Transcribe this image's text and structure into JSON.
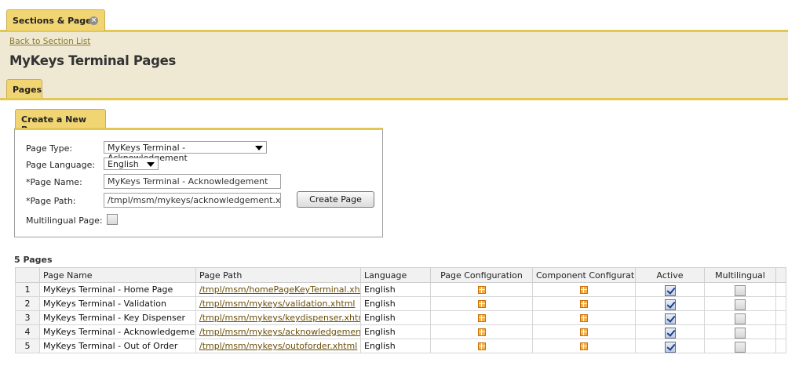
{
  "window": {
    "tab_label": "Sections & Pages",
    "close_glyph": "×"
  },
  "header": {
    "back_link": "Back to Section List",
    "title": "MyKeys Terminal Pages",
    "sub_tab": "Pages"
  },
  "create_form": {
    "tab_label": "Create a New Page",
    "page_type_label": "Page Type:",
    "page_type_value": "MyKeys Terminal - Acknowledgement",
    "page_language_label": "Page Language:",
    "page_language_value": "English",
    "page_name_label": "*Page Name:",
    "page_name_value": "MyKeys Terminal - Acknowledgement",
    "page_path_label": "*Page Path:",
    "page_path_value": "/tmpl/msm/mykeys/acknowledgement.xhtml",
    "create_button": "Create Page",
    "multilingual_label": "Multilingual Page:",
    "multilingual_checked": false
  },
  "pages_table": {
    "count_label": "5 Pages",
    "columns": [
      "",
      "Page Name",
      "Page Path",
      "Language",
      "Page Configuration",
      "Component Configuration",
      "Active",
      "Multilingual"
    ],
    "rows": [
      {
        "num": "1",
        "name": "MyKeys Terminal - Home Page",
        "path": "/tmpl/msm/homePageKeyTerminal.xhtml",
        "language": "English",
        "active": true,
        "multilingual": false
      },
      {
        "num": "2",
        "name": "MyKeys Terminal - Validation",
        "path": "/tmpl/msm/mykeys/validation.xhtml",
        "language": "English",
        "active": true,
        "multilingual": false
      },
      {
        "num": "3",
        "name": "MyKeys Terminal - Key Dispenser",
        "path": "/tmpl/msm/mykeys/keydispenser.xhtml",
        "language": "English",
        "active": true,
        "multilingual": false
      },
      {
        "num": "4",
        "name": "MyKeys Terminal - Acknowledgement",
        "path": "/tmpl/msm/mykeys/acknowledgement.xhtml",
        "language": "English",
        "active": true,
        "multilingual": false
      },
      {
        "num": "5",
        "name": "MyKeys Terminal - Out of Order",
        "path": "/tmpl/msm/mykeys/outoforder.xhtml",
        "language": "English",
        "active": true,
        "multilingual": false
      }
    ]
  },
  "colors": {
    "tab_gold": "#f2d573",
    "rule_gold": "#e2c752",
    "header_bg": "#efe9d4",
    "link_brown": "#6b4f0a"
  },
  "icons": {
    "config": "configure-grid-icon",
    "close": "close-icon"
  }
}
